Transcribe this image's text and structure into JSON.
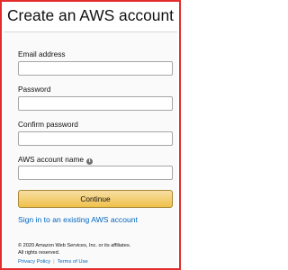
{
  "header": {
    "title": "Create an AWS account"
  },
  "form": {
    "email": {
      "label": "Email address",
      "value": "",
      "placeholder": ""
    },
    "password": {
      "label": "Password",
      "value": "",
      "placeholder": ""
    },
    "confirm_password": {
      "label": "Confirm password",
      "value": "",
      "placeholder": ""
    },
    "account_name": {
      "label": "AWS account name",
      "value": "",
      "placeholder": "",
      "help_icon": "info-icon"
    },
    "continue_label": "Continue"
  },
  "signin_link": "Sign in to an existing AWS account",
  "footer": {
    "copyright_line1": "© 2020 Amazon Web Services, Inc. or its affiliates.",
    "copyright_line2": "All rights reserved.",
    "privacy_label": "Privacy Policy",
    "separator": "|",
    "terms_label": "Terms of Use"
  },
  "colors": {
    "frame_border": "#e32d2d",
    "button_yellow": "#f0c14b",
    "link_blue": "#0066c0",
    "panel_bg": "#fafafa"
  }
}
